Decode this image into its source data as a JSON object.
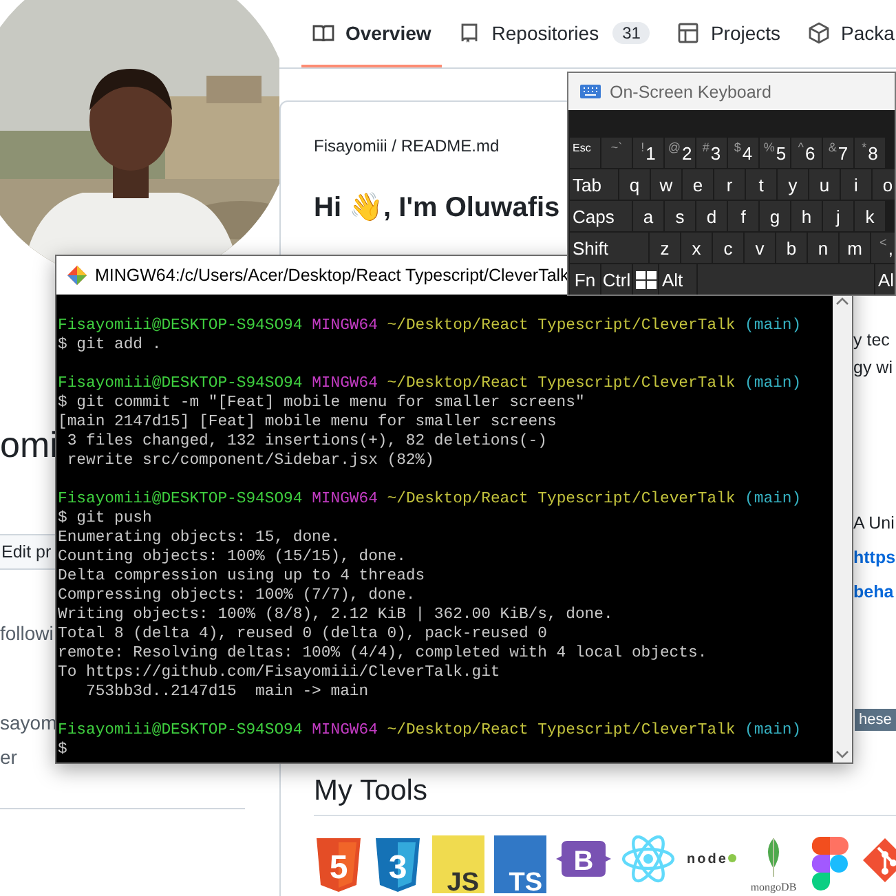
{
  "profile": {
    "avatar": {
      "kind": "picture"
    },
    "name": "omi",
    "edit_button": "Edit pr",
    "details": [
      "followi",
      "sayom",
      "er"
    ]
  },
  "tabs": [
    {
      "label": "Overview",
      "selected": true
    },
    {
      "label": "Repositories",
      "count": "31",
      "selected": false
    },
    {
      "label": "Projects",
      "selected": false
    },
    {
      "label": "Packa",
      "selected": false
    }
  ],
  "readme": {
    "path": "Fisayomiii / README.md",
    "heading": "Hi 👋, I'm Oluwafis",
    "intro_lines": [
      {
        "kind": "text",
        "text": "y tec"
      },
      {
        "kind": "text",
        "text": "gy wi"
      }
    ],
    "about_lines": [
      {
        "kind": "text",
        "text": "A Uni"
      },
      {
        "kind": "link",
        "text": "https"
      },
      {
        "kind": "link",
        "text": "beha"
      }
    ],
    "badge": "hese",
    "tools_title": "My Tools",
    "tools": [
      {
        "kind": "html5",
        "label": "5"
      },
      {
        "kind": "css3",
        "label": "3"
      },
      {
        "kind": "js",
        "label": "JS"
      },
      {
        "kind": "ts",
        "label": "TS"
      },
      {
        "kind": "bootstrap",
        "label": "B"
      },
      {
        "kind": "react"
      },
      {
        "kind": "node",
        "label": "node"
      },
      {
        "kind": "mongo",
        "label": "mongoDB"
      },
      {
        "kind": "figma"
      },
      {
        "kind": "git"
      }
    ]
  },
  "terminal": {
    "title": "MINGW64:/c/Users/Acer/Desktop/React Typescript/CleverTalk",
    "lines": [
      {
        "kind": "prompt",
        "user": "Fisayomiii@DESKTOP-S94SO94",
        "system": "MINGW64",
        "path": "~/Desktop/React Typescript/CleverTalk",
        "branch": "(main)"
      },
      {
        "kind": "output",
        "text": "$ git add ."
      },
      {
        "kind": "blank"
      },
      {
        "kind": "prompt",
        "user": "Fisayomiii@DESKTOP-S94SO94",
        "system": "MINGW64",
        "path": "~/Desktop/React Typescript/CleverTalk",
        "branch": "(main)"
      },
      {
        "kind": "output",
        "text": "$ git commit -m \"[Feat] mobile menu for smaller screens\""
      },
      {
        "kind": "output",
        "text": "[main 2147d15] [Feat] mobile menu for smaller screens"
      },
      {
        "kind": "output",
        "text": " 3 files changed, 132 insertions(+), 82 deletions(-)"
      },
      {
        "kind": "output",
        "text": " rewrite src/component/Sidebar.jsx (82%)"
      },
      {
        "kind": "blank"
      },
      {
        "kind": "prompt",
        "user": "Fisayomiii@DESKTOP-S94SO94",
        "system": "MINGW64",
        "path": "~/Desktop/React Typescript/CleverTalk",
        "branch": "(main)"
      },
      {
        "kind": "output",
        "text": "$ git push"
      },
      {
        "kind": "output",
        "text": "Enumerating objects: 15, done."
      },
      {
        "kind": "output",
        "text": "Counting objects: 100% (15/15), done."
      },
      {
        "kind": "output",
        "text": "Delta compression using up to 4 threads"
      },
      {
        "kind": "output",
        "text": "Compressing objects: 100% (7/7), done."
      },
      {
        "kind": "output",
        "text": "Writing objects: 100% (8/8), 2.12 KiB | 362.00 KiB/s, done."
      },
      {
        "kind": "output",
        "text": "Total 8 (delta 4), reused 0 (delta 0), pack-reused 0"
      },
      {
        "kind": "output",
        "text": "remote: Resolving deltas: 100% (4/4), completed with 4 local objects."
      },
      {
        "kind": "output",
        "text": "To https://github.com/Fisayomiii/CleverTalk.git"
      },
      {
        "kind": "output",
        "text": "   753bb3d..2147d15  main -> main"
      },
      {
        "kind": "blank"
      },
      {
        "kind": "prompt",
        "user": "Fisayomiii@DESKTOP-S94SO94",
        "system": "MINGW64",
        "path": "~/Desktop/React Typescript/CleverTalk",
        "branch": "(main)"
      },
      {
        "kind": "output",
        "text": "$"
      }
    ]
  },
  "keyboard": {
    "title": "On-Screen Keyboard",
    "rows": [
      [
        {
          "kind": "esc",
          "label": "Esc"
        },
        {
          "kind": "key",
          "top": "~`"
        },
        {
          "kind": "key",
          "top": "!",
          "label": "1"
        },
        {
          "kind": "key",
          "top": "@",
          "label": "2"
        },
        {
          "kind": "key",
          "top": "#",
          "label": "3"
        },
        {
          "kind": "key",
          "top": "$",
          "label": "4"
        },
        {
          "kind": "key",
          "top": "%",
          "label": "5"
        },
        {
          "kind": "key",
          "top": "^",
          "label": "6"
        },
        {
          "kind": "key",
          "top": "&",
          "label": "7"
        },
        {
          "kind": "key",
          "top": "*",
          "label": "8"
        }
      ],
      [
        {
          "kind": "tab",
          "label": "Tab"
        },
        {
          "kind": "key",
          "label": "q"
        },
        {
          "kind": "key",
          "label": "w"
        },
        {
          "kind": "key",
          "label": "e"
        },
        {
          "kind": "key",
          "label": "r"
        },
        {
          "kind": "key",
          "label": "t"
        },
        {
          "kind": "key",
          "label": "y"
        },
        {
          "kind": "key",
          "label": "u"
        },
        {
          "kind": "key",
          "label": "i"
        },
        {
          "kind": "key",
          "label": "o"
        }
      ],
      [
        {
          "kind": "caps",
          "label": "Caps"
        },
        {
          "kind": "key",
          "label": "a"
        },
        {
          "kind": "key",
          "label": "s"
        },
        {
          "kind": "key",
          "label": "d"
        },
        {
          "kind": "key",
          "label": "f"
        },
        {
          "kind": "key",
          "label": "g"
        },
        {
          "kind": "key",
          "label": "h"
        },
        {
          "kind": "key",
          "label": "j"
        },
        {
          "kind": "key",
          "label": "k"
        }
      ],
      [
        {
          "kind": "shift",
          "label": "Shift"
        },
        {
          "kind": "key",
          "label": "z"
        },
        {
          "kind": "key",
          "label": "x"
        },
        {
          "kind": "key",
          "label": "c"
        },
        {
          "kind": "key",
          "label": "v"
        },
        {
          "kind": "key",
          "label": "b"
        },
        {
          "kind": "key",
          "label": "n"
        },
        {
          "kind": "key",
          "label": "m"
        },
        {
          "kind": "key",
          "top": "<",
          "label": ","
        }
      ],
      [
        {
          "kind": "key",
          "label": "Fn"
        },
        {
          "kind": "key",
          "label": "Ctrl"
        },
        {
          "kind": "win"
        },
        {
          "kind": "alt",
          "label": "Alt"
        },
        {
          "kind": "space"
        },
        {
          "kind": "alt",
          "label": "Al"
        }
      ]
    ]
  }
}
